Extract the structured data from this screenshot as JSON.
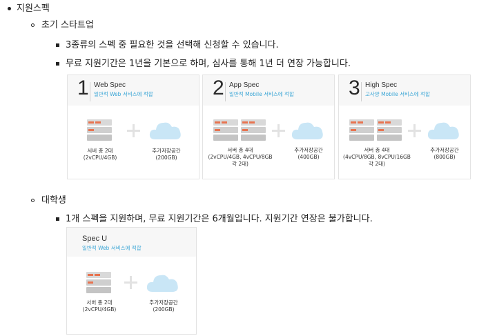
{
  "list": {
    "l1": "지원스펙",
    "startup": {
      "title": "초기 스타트업",
      "items": [
        "3종류의 스펙 중 필요한 것을 선택해 신청할 수 있습니다.",
        "무료 지원기간은 1년을 기본으로 하며, 심사를 통해 1년 더 연장 가능합니다."
      ],
      "cards": [
        {
          "num": "1",
          "name": "Web Spec",
          "desc": "일반적 Web 서비스에 적합",
          "server": [
            "서버 총 2대",
            "(2vCPU/4GB)"
          ],
          "storage": [
            "추가저장공간",
            "(200GB)"
          ]
        },
        {
          "num": "2",
          "name": "App Spec",
          "desc": "일반적 Mobile 서비스에 적합",
          "server": [
            "서버 총 4대",
            "(2vCPU/4GB, 4vCPU/8GB",
            "각 2대)"
          ],
          "storage": [
            "추가저장공간",
            "(400GB)"
          ]
        },
        {
          "num": "3",
          "name": "High Spec",
          "desc": "고사양 Mobile 서비스에 적합",
          "server": [
            "서버 총 4대",
            "(4vCPU/8GB, 8vCPU/16GB",
            "각 2대)"
          ],
          "storage": [
            "추가저장공간",
            "(800GB)"
          ]
        }
      ]
    },
    "university": {
      "title": "대학생",
      "items": [
        "1개 스펙을 지원하며, 무료 지원기간은 6개월입니다. 지원기간 연장은 불가합니다."
      ],
      "card": {
        "name": "Spec U",
        "desc": "일반적 Web 서비스에 적합",
        "server": [
          "서버 총 2대",
          "(2vCPU/4GB)"
        ],
        "storage": [
          "추가저장공간",
          "(200GB)"
        ]
      }
    }
  },
  "colors": {
    "accent": "#3ba6d6",
    "server_stripe": "#e8734f",
    "cloud": "#c9e6f6"
  }
}
